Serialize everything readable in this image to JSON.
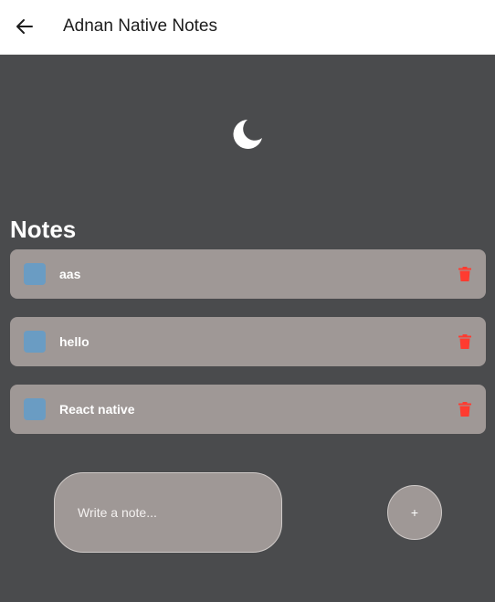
{
  "header": {
    "title": "Adnan Native Notes",
    "back_icon": "arrow-left-icon"
  },
  "theme_toggle": {
    "icon": "moon-icon",
    "mode": "dark"
  },
  "notes_section": {
    "heading": "Notes",
    "items": [
      {
        "text": "aas",
        "checked": false
      },
      {
        "text": "hello",
        "checked": false
      },
      {
        "text": "React native",
        "checked": false
      }
    ],
    "checkbox_color": "#6a9cc3",
    "delete_icon": "trash-icon",
    "delete_color": "#ff3b30"
  },
  "composer": {
    "placeholder": "Write a note...",
    "value": "",
    "add_label": "+"
  },
  "colors": {
    "background": "#4a4b4d",
    "card": "#9f9896",
    "header": "#ffffff"
  }
}
